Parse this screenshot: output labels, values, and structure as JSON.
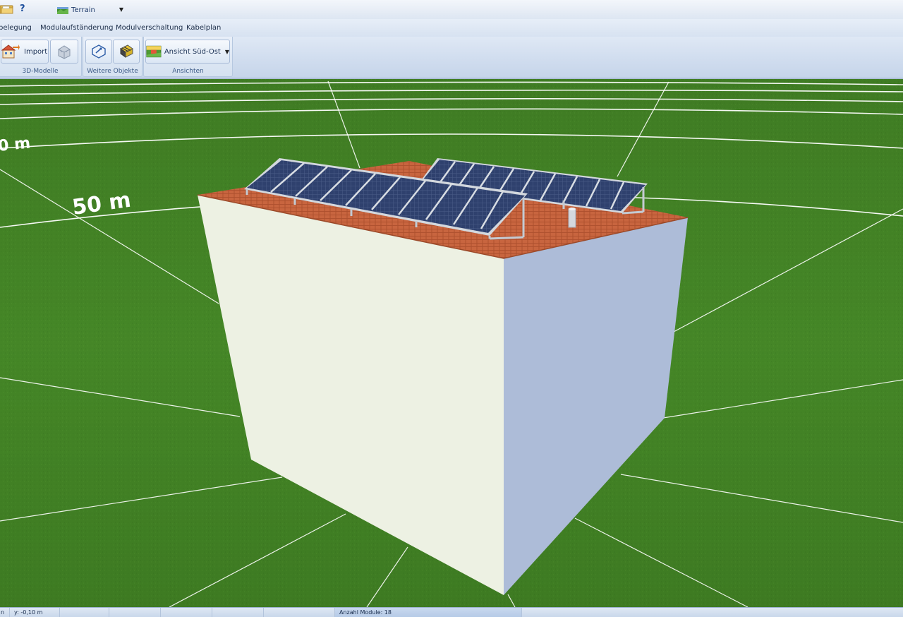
{
  "quick_access": {
    "help_label": "?",
    "terrain_label": "Terrain"
  },
  "tabs": [
    "belegung",
    "Modulaufständerung",
    "Modulverschaltung",
    "Kabelplan"
  ],
  "ribbon": {
    "groups": {
      "models": {
        "label": "3D-Modelle",
        "import_label": "Import"
      },
      "objects": {
        "label": "Weitere Objekte"
      },
      "views": {
        "label": "Ansichten",
        "view_button_label": "Ansicht Süd-Ost"
      }
    }
  },
  "viewport": {
    "distance_labels": [
      "0 m",
      "50 m"
    ],
    "colors": {
      "grass": "#3f7f24",
      "wall_front": "#edf1e3",
      "wall_side": "#adbcd8",
      "roof_tiles": "#c5633d",
      "panel": "#2e3f6b",
      "frame": "#c8ced6",
      "grid_line": "#ffffff"
    }
  },
  "status": {
    "first_cell": "n",
    "y_coord": "y: -0,10 m",
    "module_count": "Anzahl Module:  18"
  }
}
